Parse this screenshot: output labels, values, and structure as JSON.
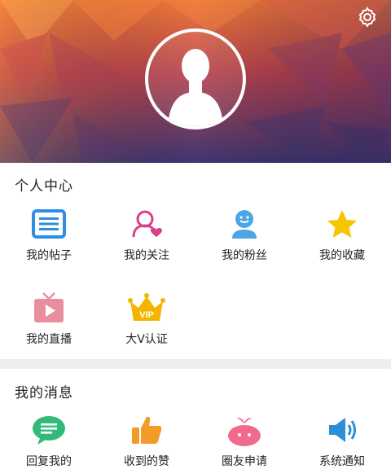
{
  "header": {
    "settings_icon": "gear-icon",
    "avatar_icon": "person-silhouette-icon"
  },
  "personal_center": {
    "title": "个人中心",
    "items": [
      {
        "label": "我的帖子",
        "icon": "post-list-icon",
        "color": "#2d8fe3"
      },
      {
        "label": "我的关注",
        "icon": "follow-person-heart-icon",
        "color": "#d93f86"
      },
      {
        "label": "我的粉丝",
        "icon": "fans-smiley-icon",
        "color": "#4aa6e6"
      },
      {
        "label": "我的收藏",
        "icon": "star-icon",
        "color": "#f7c500"
      },
      {
        "label": "我的直播",
        "icon": "tv-live-icon",
        "color": "#e88f9e"
      },
      {
        "label": "大V认证",
        "icon": "vip-crown-icon",
        "color": "#f2b600"
      }
    ]
  },
  "my_messages": {
    "title": "我的消息",
    "items": [
      {
        "label": "回复我的",
        "icon": "reply-chat-bubble-icon",
        "color": "#33b97a"
      },
      {
        "label": "收到的赞",
        "icon": "thumbs-up-icon",
        "color": "#f29b27"
      },
      {
        "label": "圈友申请",
        "icon": "friend-request-blob-icon",
        "color": "#f06b8b"
      },
      {
        "label": "系统通知",
        "icon": "speaker-icon",
        "color": "#2e8fd9"
      }
    ]
  }
}
